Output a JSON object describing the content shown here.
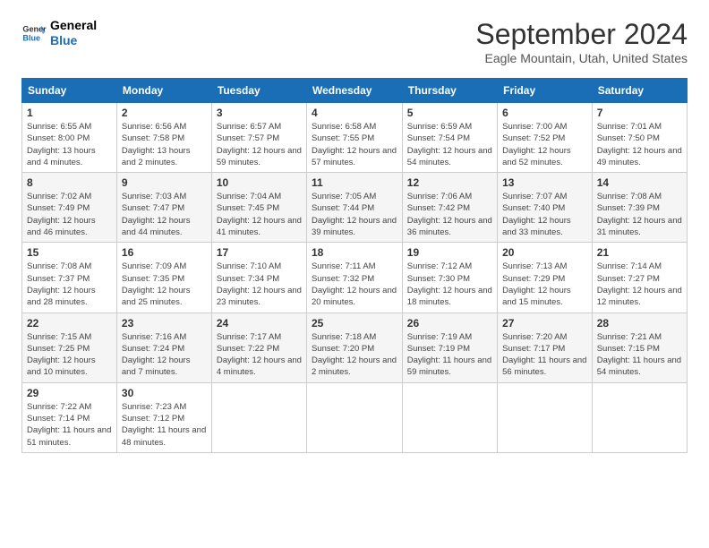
{
  "logo": {
    "line1": "General",
    "line2": "Blue"
  },
  "title": "September 2024",
  "location": "Eagle Mountain, Utah, United States",
  "weekdays": [
    "Sunday",
    "Monday",
    "Tuesday",
    "Wednesday",
    "Thursday",
    "Friday",
    "Saturday"
  ],
  "weeks": [
    [
      {
        "day": "1",
        "sunrise": "6:55 AM",
        "sunset": "8:00 PM",
        "daylight": "13 hours and 4 minutes."
      },
      {
        "day": "2",
        "sunrise": "6:56 AM",
        "sunset": "7:58 PM",
        "daylight": "13 hours and 2 minutes."
      },
      {
        "day": "3",
        "sunrise": "6:57 AM",
        "sunset": "7:57 PM",
        "daylight": "12 hours and 59 minutes."
      },
      {
        "day": "4",
        "sunrise": "6:58 AM",
        "sunset": "7:55 PM",
        "daylight": "12 hours and 57 minutes."
      },
      {
        "day": "5",
        "sunrise": "6:59 AM",
        "sunset": "7:54 PM",
        "daylight": "12 hours and 54 minutes."
      },
      {
        "day": "6",
        "sunrise": "7:00 AM",
        "sunset": "7:52 PM",
        "daylight": "12 hours and 52 minutes."
      },
      {
        "day": "7",
        "sunrise": "7:01 AM",
        "sunset": "7:50 PM",
        "daylight": "12 hours and 49 minutes."
      }
    ],
    [
      {
        "day": "8",
        "sunrise": "7:02 AM",
        "sunset": "7:49 PM",
        "daylight": "12 hours and 46 minutes."
      },
      {
        "day": "9",
        "sunrise": "7:03 AM",
        "sunset": "7:47 PM",
        "daylight": "12 hours and 44 minutes."
      },
      {
        "day": "10",
        "sunrise": "7:04 AM",
        "sunset": "7:45 PM",
        "daylight": "12 hours and 41 minutes."
      },
      {
        "day": "11",
        "sunrise": "7:05 AM",
        "sunset": "7:44 PM",
        "daylight": "12 hours and 39 minutes."
      },
      {
        "day": "12",
        "sunrise": "7:06 AM",
        "sunset": "7:42 PM",
        "daylight": "12 hours and 36 minutes."
      },
      {
        "day": "13",
        "sunrise": "7:07 AM",
        "sunset": "7:40 PM",
        "daylight": "12 hours and 33 minutes."
      },
      {
        "day": "14",
        "sunrise": "7:08 AM",
        "sunset": "7:39 PM",
        "daylight": "12 hours and 31 minutes."
      }
    ],
    [
      {
        "day": "15",
        "sunrise": "7:08 AM",
        "sunset": "7:37 PM",
        "daylight": "12 hours and 28 minutes."
      },
      {
        "day": "16",
        "sunrise": "7:09 AM",
        "sunset": "7:35 PM",
        "daylight": "12 hours and 25 minutes."
      },
      {
        "day": "17",
        "sunrise": "7:10 AM",
        "sunset": "7:34 PM",
        "daylight": "12 hours and 23 minutes."
      },
      {
        "day": "18",
        "sunrise": "7:11 AM",
        "sunset": "7:32 PM",
        "daylight": "12 hours and 20 minutes."
      },
      {
        "day": "19",
        "sunrise": "7:12 AM",
        "sunset": "7:30 PM",
        "daylight": "12 hours and 18 minutes."
      },
      {
        "day": "20",
        "sunrise": "7:13 AM",
        "sunset": "7:29 PM",
        "daylight": "12 hours and 15 minutes."
      },
      {
        "day": "21",
        "sunrise": "7:14 AM",
        "sunset": "7:27 PM",
        "daylight": "12 hours and 12 minutes."
      }
    ],
    [
      {
        "day": "22",
        "sunrise": "7:15 AM",
        "sunset": "7:25 PM",
        "daylight": "12 hours and 10 minutes."
      },
      {
        "day": "23",
        "sunrise": "7:16 AM",
        "sunset": "7:24 PM",
        "daylight": "12 hours and 7 minutes."
      },
      {
        "day": "24",
        "sunrise": "7:17 AM",
        "sunset": "7:22 PM",
        "daylight": "12 hours and 4 minutes."
      },
      {
        "day": "25",
        "sunrise": "7:18 AM",
        "sunset": "7:20 PM",
        "daylight": "12 hours and 2 minutes."
      },
      {
        "day": "26",
        "sunrise": "7:19 AM",
        "sunset": "7:19 PM",
        "daylight": "11 hours and 59 minutes."
      },
      {
        "day": "27",
        "sunrise": "7:20 AM",
        "sunset": "7:17 PM",
        "daylight": "11 hours and 56 minutes."
      },
      {
        "day": "28",
        "sunrise": "7:21 AM",
        "sunset": "7:15 PM",
        "daylight": "11 hours and 54 minutes."
      }
    ],
    [
      {
        "day": "29",
        "sunrise": "7:22 AM",
        "sunset": "7:14 PM",
        "daylight": "11 hours and 51 minutes."
      },
      {
        "day": "30",
        "sunrise": "7:23 AM",
        "sunset": "7:12 PM",
        "daylight": "11 hours and 48 minutes."
      },
      null,
      null,
      null,
      null,
      null
    ]
  ]
}
